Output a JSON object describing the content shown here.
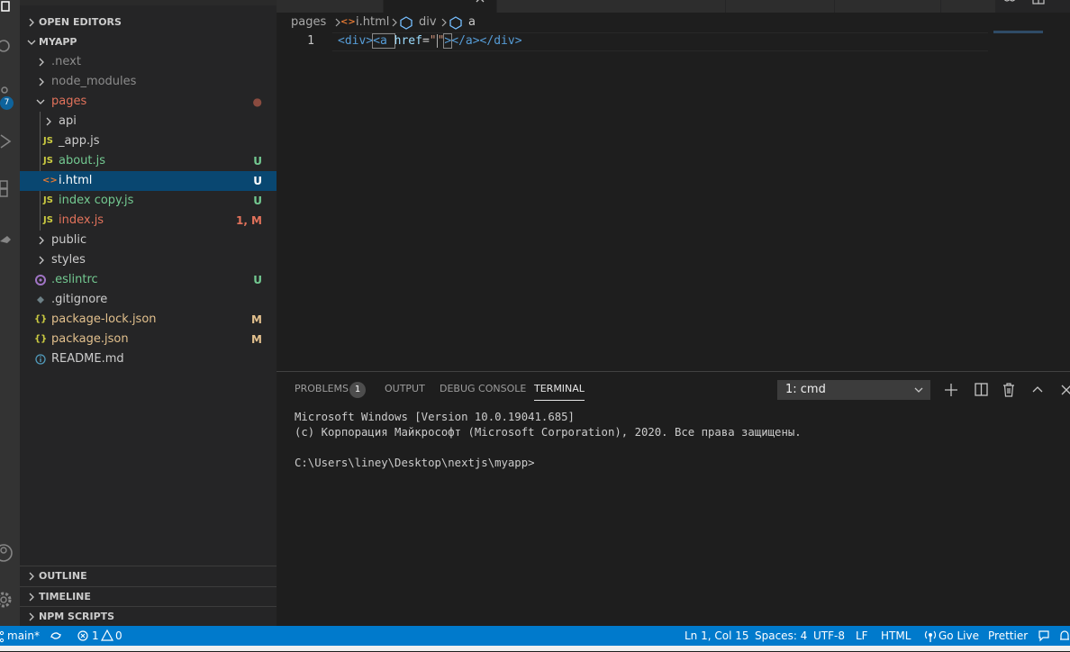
{
  "activity": {
    "scm_badge": "7"
  },
  "sidebar": {
    "open_editors": "OPEN EDITORS",
    "project": "MYAPP",
    "tree": [
      {
        "label": ".next",
        "kind": "folder",
        "status": ""
      },
      {
        "label": "node_modules",
        "kind": "folder",
        "status": ""
      },
      {
        "label": "pages",
        "kind": "folder-open",
        "status": "●"
      },
      {
        "label": "api",
        "kind": "folder",
        "status": ""
      },
      {
        "label": "_app.js",
        "kind": "js",
        "status": ""
      },
      {
        "label": "about.js",
        "kind": "js",
        "status": "U"
      },
      {
        "label": "i.html",
        "kind": "html",
        "status": "U"
      },
      {
        "label": "index copy.js",
        "kind": "js",
        "status": "U"
      },
      {
        "label": "index.js",
        "kind": "js",
        "status": "1, M"
      },
      {
        "label": "public",
        "kind": "folder",
        "status": ""
      },
      {
        "label": "styles",
        "kind": "folder",
        "status": ""
      },
      {
        "label": ".eslintrc",
        "kind": "eslint",
        "status": "U"
      },
      {
        "label": ".gitignore",
        "kind": "git",
        "status": ""
      },
      {
        "label": "package-lock.json",
        "kind": "json",
        "status": "M"
      },
      {
        "label": "package.json",
        "kind": "json",
        "status": "M"
      },
      {
        "label": "README.md",
        "kind": "info",
        "status": ""
      }
    ],
    "icons": {
      "js": "JS",
      "html": "<>",
      "json": "{}"
    },
    "outline": "OUTLINE",
    "timeline": "TIMELINE",
    "npm_scripts": "NPM SCRIPTS"
  },
  "editor": {
    "breadcrumb": [
      "pages",
      "i.html",
      "div",
      "a"
    ],
    "line_number": "1",
    "code": {
      "open_div": "<div>",
      "a_open": "<a ",
      "attr": "href",
      "eq": "=",
      "q1": "\"",
      "q2": "\"",
      "close_a": ">",
      "rest": "</a></div>"
    }
  },
  "panel": {
    "tabs": [
      "PROBLEMS",
      "OUTPUT",
      "DEBUG CONSOLE",
      "TERMINAL"
    ],
    "problems_count": "1",
    "terminal_select": "1: cmd",
    "terminal_lines": [
      "Microsoft Windows [Version 10.0.19041.685]",
      "(c) Корпорация Майкрософт (Microsoft Corporation), 2020. Все права защищены.",
      "",
      "C:\\Users\\liney\\Desktop\\nextjs\\myapp>"
    ]
  },
  "status": {
    "branch": "main*",
    "errors": "1",
    "warnings": "0",
    "position": "Ln 1, Col 15",
    "spaces": "Spaces: 4",
    "encoding": "UTF-8",
    "eol": "LF",
    "language": "HTML",
    "golive": "Go Live",
    "prettier": "Prettier"
  },
  "colors": {
    "accent": "#007acc",
    "selection": "#094771",
    "untracked": "#73c991",
    "error": "#e2725b",
    "modified": "#e2c08d"
  }
}
